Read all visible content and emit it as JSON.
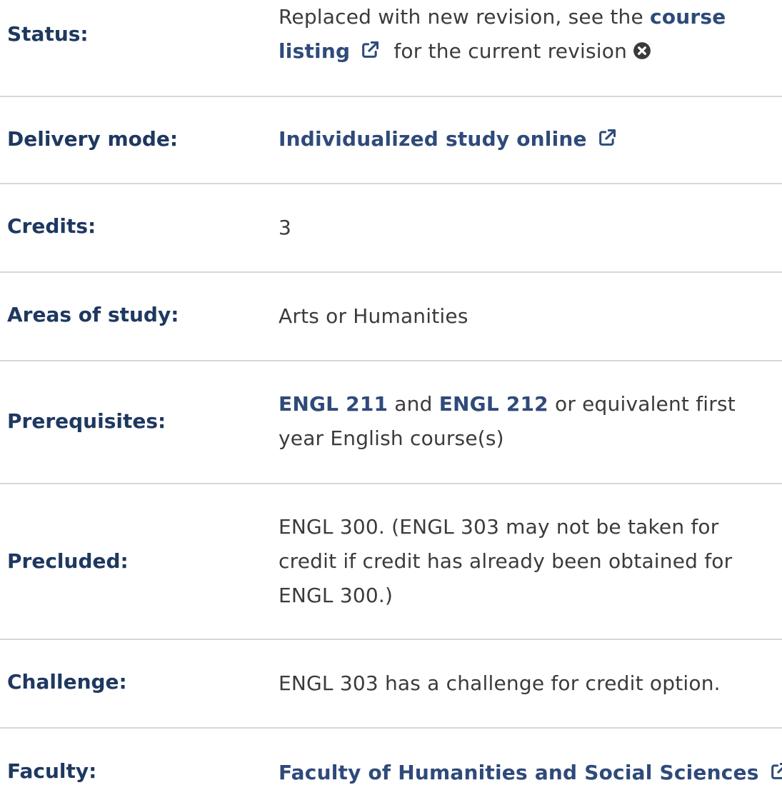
{
  "rows": {
    "status": {
      "label": "Status:",
      "text_before": "Replaced with new revision, see the",
      "link": "course listing",
      "text_after": "for the current revision"
    },
    "delivery": {
      "label": "Delivery mode:",
      "link": "Individualized study online"
    },
    "credits": {
      "label": "Credits:",
      "value": "3"
    },
    "areas": {
      "label": "Areas of study:",
      "value": "Arts or Humanities"
    },
    "prereq": {
      "label": "Prerequisites:",
      "link1": "ENGL 211",
      "and": "and",
      "link2": "ENGL 212",
      "rest": "or equivalent first year English course(s)"
    },
    "precluded": {
      "label": "Precluded:",
      "value": "ENGL 300. (ENGL 303 may not be taken for credit if credit has already been obtained for ENGL 300.)"
    },
    "challenge": {
      "label": "Challenge:",
      "value": "ENGL 303 has a challenge for credit option."
    },
    "faculty": {
      "label": "Faculty:",
      "link": "Faculty of Humanities and Social Sciences"
    }
  },
  "colors": {
    "label": "#1e3860",
    "link": "#2f4a7a",
    "text": "#3b3b3b",
    "divider": "#d7d7d7"
  },
  "icons": {
    "external_link": "external-link-icon",
    "close": "close-circle-icon"
  }
}
